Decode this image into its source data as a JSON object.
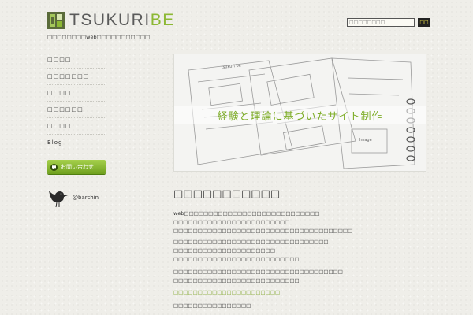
{
  "header": {
    "logo_main": "TSUKURI",
    "logo_accent": "BE",
    "tagline": "□□□□□□□□web□□□□□□□□□□□"
  },
  "search": {
    "placeholder": "□□□□□□□□",
    "button_label": "□□"
  },
  "nav": {
    "items": [
      {
        "label": "□□□□"
      },
      {
        "label": "□□□□□□□"
      },
      {
        "label": "□□□□"
      },
      {
        "label": "□□□□□□"
      },
      {
        "label": "□□□□"
      },
      {
        "label": "Blog"
      }
    ]
  },
  "contact": {
    "label": "お問い合わせ",
    "icon": "speech-bubble-icon"
  },
  "twitter": {
    "handle": "@barchin",
    "icon": "bird-icon"
  },
  "hero": {
    "caption": "経験と理論に基づいたサイト制作"
  },
  "main": {
    "title": "□□□□□□□□□□□",
    "paragraphs": [
      [
        "web□□□□□□□□□□□□□□□□□□□□□□□□□□□□",
        "□□□□□□□□□□□□□□□□□□□□□□□□",
        "□□□□□□□□□□□□□□□□□□□□□□□□□□□□□□□□□□□□□"
      ],
      [
        "□□□□□□□□□□□□□□□□□□□□□□□□□□□□□□□□",
        "□□□□□□□□□□□□□□□□□□□□□",
        "□□□□□□□□□□□□□□□□□□□□□□□□□□"
      ],
      [
        "□□□□□□□□□□□□□□□□□□□□□□□□□□□□□□□□□□□",
        "□□□□□□□□□□□□□□□□□□□□□□□□□□"
      ]
    ],
    "link": "□□□□□□□□□□□□□□□□□□□□□□",
    "last_line": "□□□□□□□□□□□□□□□□"
  },
  "colors": {
    "accent": "#8cb834",
    "background": "#efeee9",
    "text": "#333333"
  }
}
